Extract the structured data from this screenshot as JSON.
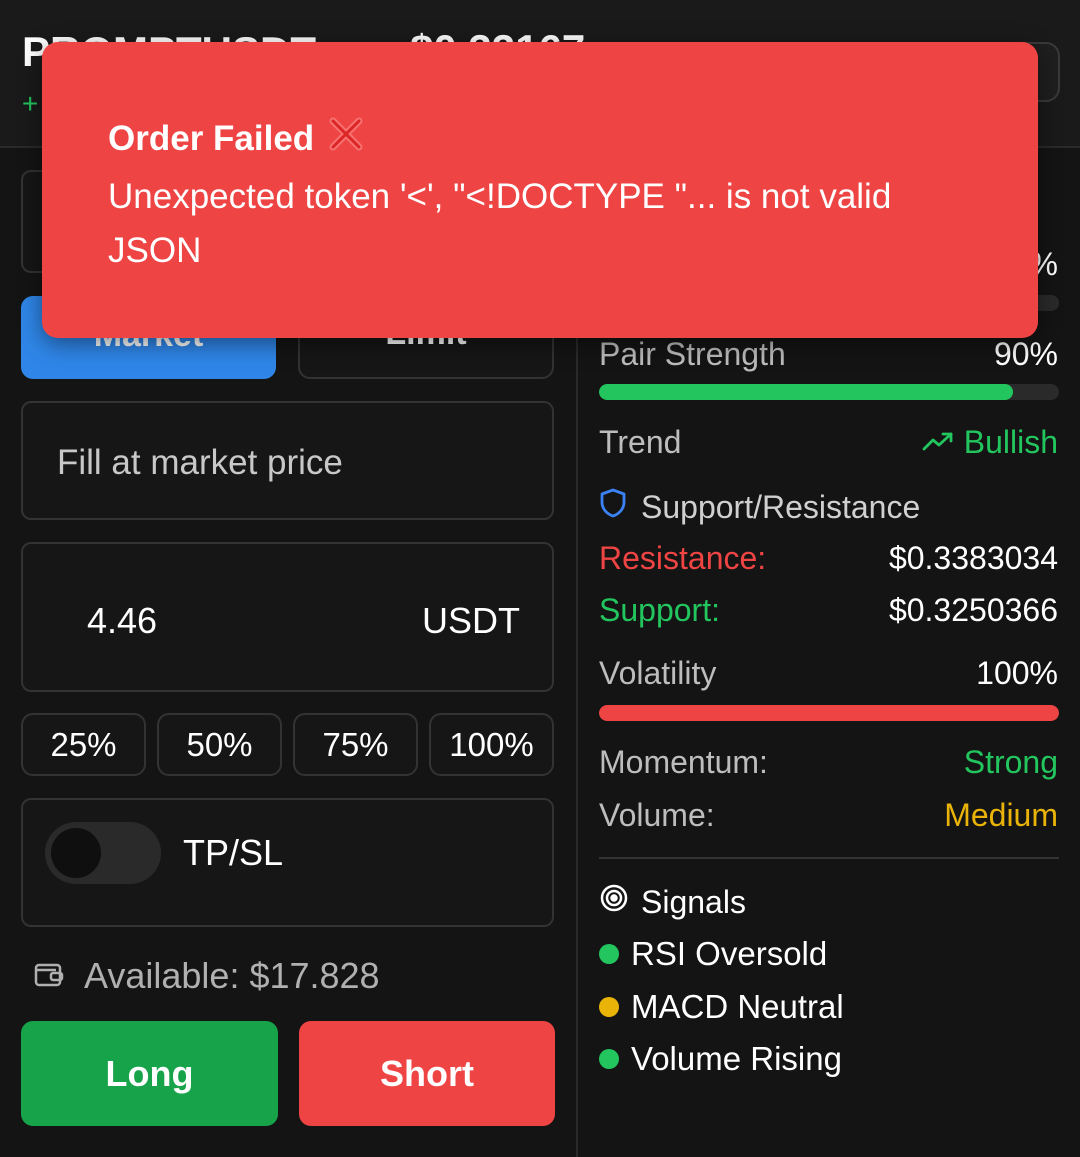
{
  "header": {
    "symbol": "PROMPTUSDT",
    "price": "$0.33167",
    "change": "+"
  },
  "order": {
    "tabs": {
      "market": "Market",
      "limit": "Limit"
    },
    "fill_text": "Fill at market price",
    "amount": "4.46",
    "currency": "USDT",
    "percentages": [
      "25%",
      "50%",
      "75%",
      "100%"
    ],
    "tpsl_label": "TP/SL",
    "tpsl_enabled": false,
    "available": "Available: $17.828",
    "long_label": "Long",
    "short_label": "Short"
  },
  "analysis": {
    "top_value": "%",
    "pair_strength_label": "Pair Strength",
    "pair_strength_value": "90%",
    "pair_strength_level": 0.9,
    "trend_label": "Trend",
    "trend_value": "Bullish",
    "sr_title": "Support/Resistance",
    "resistance_label": "Resistance:",
    "resistance_value": "$0.3383034",
    "support_label": "Support:",
    "support_value": "$0.3250366",
    "volatility_label": "Volatility",
    "volatility_value": "100%",
    "volatility_level": 1.0,
    "momentum_label": "Momentum:",
    "momentum_value": "Strong",
    "volume_label": "Volume:",
    "volume_value": "Medium",
    "signals_title": "Signals",
    "signals": [
      {
        "label": "RSI Oversold",
        "color": "#22c55e"
      },
      {
        "label": "MACD Neutral",
        "color": "#eab308"
      },
      {
        "label": "Volume Rising",
        "color": "#22c55e"
      }
    ]
  },
  "toast": {
    "title": "Order Failed",
    "icon": "cross-mark-icon",
    "message": "Unexpected token '<', \"<!DOCTYPE \"... is not valid JSON"
  },
  "colors": {
    "accent_blue": "#2f86e8",
    "long_green": "#16a34a",
    "short_red": "#ef4444",
    "positive": "#22c55e",
    "warning": "#eab308"
  }
}
